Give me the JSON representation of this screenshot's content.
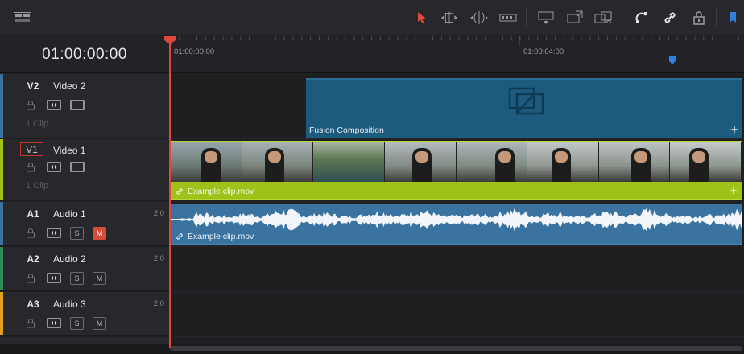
{
  "toolbar": {
    "icons": [
      "layout-icon",
      "selection-arrow-icon",
      "trim-icon",
      "dynamic-trim-icon",
      "blade-icon",
      "insert-clip-icon",
      "overwrite-clip-icon",
      "replace-clip-icon",
      "snapping-icon",
      "linked-selection-icon",
      "lock-icon",
      "flag-icon"
    ]
  },
  "timeline": {
    "timecode": "01:00:00:00",
    "ruler": [
      "01:00:00:00",
      "01:00:04:00"
    ]
  },
  "tracks": {
    "v2": {
      "id": "V2",
      "name": "Video 2",
      "clips": "1 Clip",
      "color": "#3b73a0"
    },
    "v1": {
      "id": "V1",
      "name": "Video 1",
      "clips": "1 Clip",
      "color": "#9ec21a"
    },
    "a1": {
      "id": "A1",
      "name": "Audio 1",
      "channels": "2.0",
      "solo": "S",
      "mute": "M",
      "color": "#3b73a0"
    },
    "a2": {
      "id": "A2",
      "name": "Audio 2",
      "channels": "2.0",
      "solo": "S",
      "mute": "M",
      "color": "#2e8b57"
    },
    "a3": {
      "id": "A3",
      "name": "Audio 3",
      "channels": "2.0",
      "solo": "S",
      "mute": "M",
      "color": "#e0a020"
    }
  },
  "clips": {
    "fusion": {
      "label": "Fusion Composition",
      "color": "#1c5a7e"
    },
    "video": {
      "label": "Example clip.mov",
      "color": "#9ec21a"
    },
    "audio": {
      "label": "Example clip.mov",
      "color": "#3b73a0"
    }
  },
  "colors": {
    "playhead": "#e0473a",
    "marker": "#2f7fe0"
  }
}
